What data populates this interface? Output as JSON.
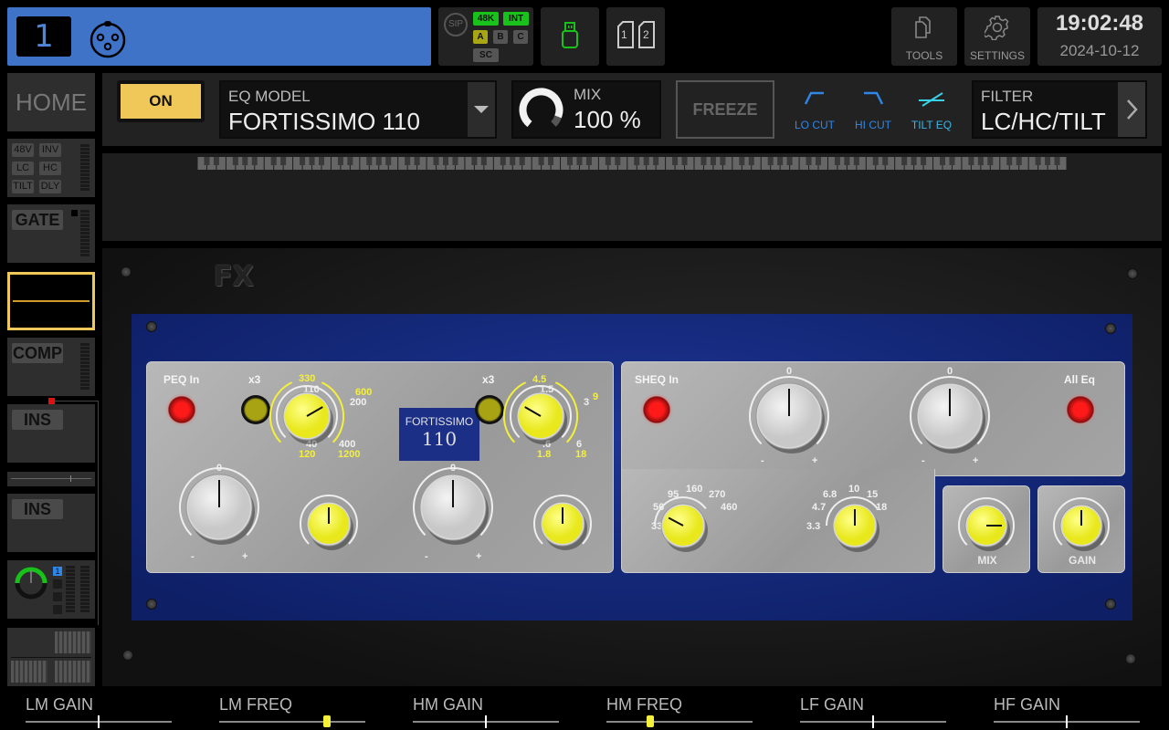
{
  "header": {
    "channel_number": "1",
    "channel_icon": "xlr-connector-icon",
    "status": {
      "sip_label": "SIP",
      "sample_rate": "48K",
      "clock_source": "INT",
      "buses": [
        "A",
        "B",
        "C"
      ],
      "sc_label": "SC",
      "colors": {
        "active": "#19c21a",
        "selected": "#a8a614"
      }
    },
    "usb_icon": "usb-drive-icon",
    "sd_cards": [
      "1",
      "2"
    ],
    "tools_label": "TOOLS",
    "settings_label": "SETTINGS",
    "time": "19:02:48",
    "date": "2024-10-12"
  },
  "sidebar": {
    "home_label": "HOME",
    "preamp_tags": [
      "48V",
      "INV",
      "LC",
      "HC",
      "TILT",
      "DLY"
    ],
    "gate_label": "GATE",
    "comp_label": "COMP",
    "insert1_label": "INS",
    "insert2_label": "INS",
    "bus_badge": "1"
  },
  "toolbar": {
    "on_label": "ON",
    "eq_model_label": "EQ MODEL",
    "eq_model_value": "FORTISSIMO 110",
    "mix_label": "MIX",
    "mix_value": "100 %",
    "mix_fraction": 1.0,
    "freeze_label": "FREEZE",
    "filters": [
      {
        "label": "LO CUT",
        "icon": "lo-cut-icon"
      },
      {
        "label": "HI CUT",
        "icon": "hi-cut-icon"
      },
      {
        "label": "TILT EQ",
        "icon": "tilt-eq-icon"
      }
    ],
    "filter_label": "FILTER",
    "filter_value": "LC/HC/TILT",
    "accent": "#f0c85a",
    "filter_color": "#2f86e6"
  },
  "plugin": {
    "logo": "FX",
    "brand_name": "FORTISSIMO",
    "brand_model": "110",
    "peq": {
      "in_label": "PEQ In",
      "x3_label_lm": "x3",
      "x3_label_hm": "x3",
      "lm_freq_scale_white": [
        "110",
        "200",
        "40",
        "400"
      ],
      "lm_freq_scale_yellow": [
        "330",
        "600",
        "120",
        "1200"
      ],
      "hm_freq_scale_white": [
        "1.5",
        "3",
        ".6",
        "6"
      ],
      "hm_freq_scale_yellow": [
        "4.5",
        "9",
        "1.8",
        "18"
      ],
      "gain_zero": "0",
      "gain_minus": "-",
      "gain_plus": "+"
    },
    "sheq": {
      "in_label": "SHEQ In",
      "all_eq_label": "All Eq",
      "gain_zero": "0",
      "gain_minus": "-",
      "gain_plus": "+",
      "lf_freq_scale": [
        "33",
        "56",
        "95",
        "160",
        "270",
        "460"
      ],
      "hf_freq_scale": [
        "3.3",
        "4.7",
        "6.8",
        "10",
        "15",
        "18"
      ]
    },
    "mix_label": "MIX",
    "gain_label": "GAIN"
  },
  "params": [
    {
      "label": "LM GAIN",
      "value": 0.5,
      "style": "center"
    },
    {
      "label": "LM FREQ",
      "value": 0.74,
      "style": "thumb"
    },
    {
      "label": "HM GAIN",
      "value": 0.5,
      "style": "center"
    },
    {
      "label": "HM FREQ",
      "value": 0.3,
      "style": "thumb"
    },
    {
      "label": "LF GAIN",
      "value": 0.5,
      "style": "center"
    },
    {
      "label": "HF GAIN",
      "value": 0.5,
      "style": "center"
    }
  ]
}
